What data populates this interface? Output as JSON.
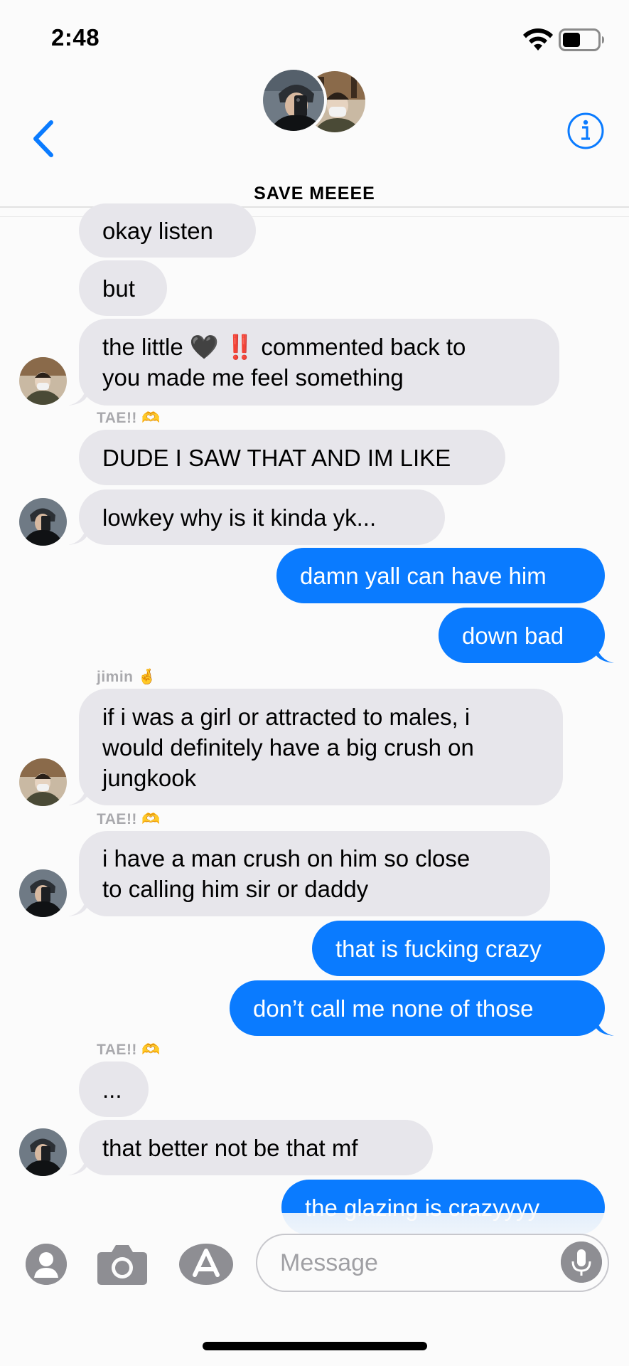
{
  "status_bar": {
    "time": "2:48"
  },
  "header": {
    "group_name": "SAVE MEEEE"
  },
  "colors": {
    "accent": "#0a7bff",
    "incoming_bubble": "#e7e6eb",
    "sender_name": "#a9a9ad"
  },
  "messages": [
    {
      "text": "okay listen"
    },
    {
      "text": "but"
    },
    {
      "text": "the little 🖤 ‼️ commented back to\nyou made me feel something"
    },
    {
      "sender": "TAE!! 🫶",
      "text": "DUDE I SAW THAT AND IM LIKE"
    },
    {
      "text": "lowkey why is it kinda yk..."
    },
    {
      "text": "damn yall can have him"
    },
    {
      "text": "down bad"
    },
    {
      "sender": "jimin 🤞",
      "text": "if i was a girl or attracted to males, i\nwould definitely have a big crush on\njungkook"
    },
    {
      "sender": "TAE!! 🫶",
      "text": "i have a man crush on him so close\nto calling him sir or daddy"
    },
    {
      "text": "that is fucking crazy"
    },
    {
      "text": "don’t call me none of those"
    },
    {
      "sender": "TAE!! 🫶",
      "text": "..."
    },
    {
      "text": "that better not be that mf"
    },
    {
      "text": "the glazing is crazyyyy"
    }
  ],
  "composer": {
    "placeholder": "Message"
  },
  "icons": {
    "back": "chevron-left-icon",
    "info": "info-icon",
    "wifi": "wifi-icon",
    "battery": "battery-icon",
    "contact": "person-icon",
    "camera": "camera-icon",
    "appstore": "app-store-icon",
    "mic": "microphone-icon"
  }
}
